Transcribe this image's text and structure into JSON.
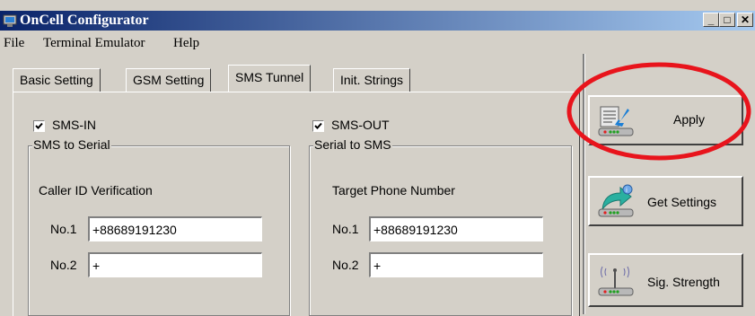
{
  "window": {
    "title": "OnCell Configurator"
  },
  "titlebar_buttons": {
    "minimize": "_",
    "maximize": "□",
    "close": "✕"
  },
  "menu": [
    {
      "label": "File"
    },
    {
      "label": "Terminal Emulator"
    },
    {
      "label": "Help"
    }
  ],
  "tabs": [
    {
      "label": "Basic Setting"
    },
    {
      "label": "GSM Setting"
    },
    {
      "label": "SMS Tunnel"
    },
    {
      "label": "Init. Strings"
    }
  ],
  "active_tab": "SMS Tunnel",
  "sms_in": {
    "checkbox_label": "SMS-IN",
    "checked": true,
    "group_title": "SMS to Serial",
    "section_label": "Caller ID Verification",
    "no1_label": "No.1",
    "no1_value": "+88689191230",
    "no2_label": "No.2",
    "no2_value": "+"
  },
  "sms_out": {
    "checkbox_label": "SMS-OUT",
    "checked": true,
    "group_title": "Serial to SMS",
    "section_label": "Target Phone Number",
    "no1_label": "No.1",
    "no1_value": "+88689191230",
    "no2_label": "No.2",
    "no2_value": "+"
  },
  "side_buttons": {
    "apply": {
      "label": "Apply",
      "icon": "apply-icon"
    },
    "get_settings": {
      "label": "Get Settings",
      "icon": "get-settings-icon"
    },
    "sig_strength": {
      "label": "Sig. Strength",
      "icon": "signal-tower-icon"
    }
  },
  "colors": {
    "highlight": "#e8141c",
    "title_bar_start": "#0a246a",
    "title_bar_end": "#a6caf0"
  }
}
